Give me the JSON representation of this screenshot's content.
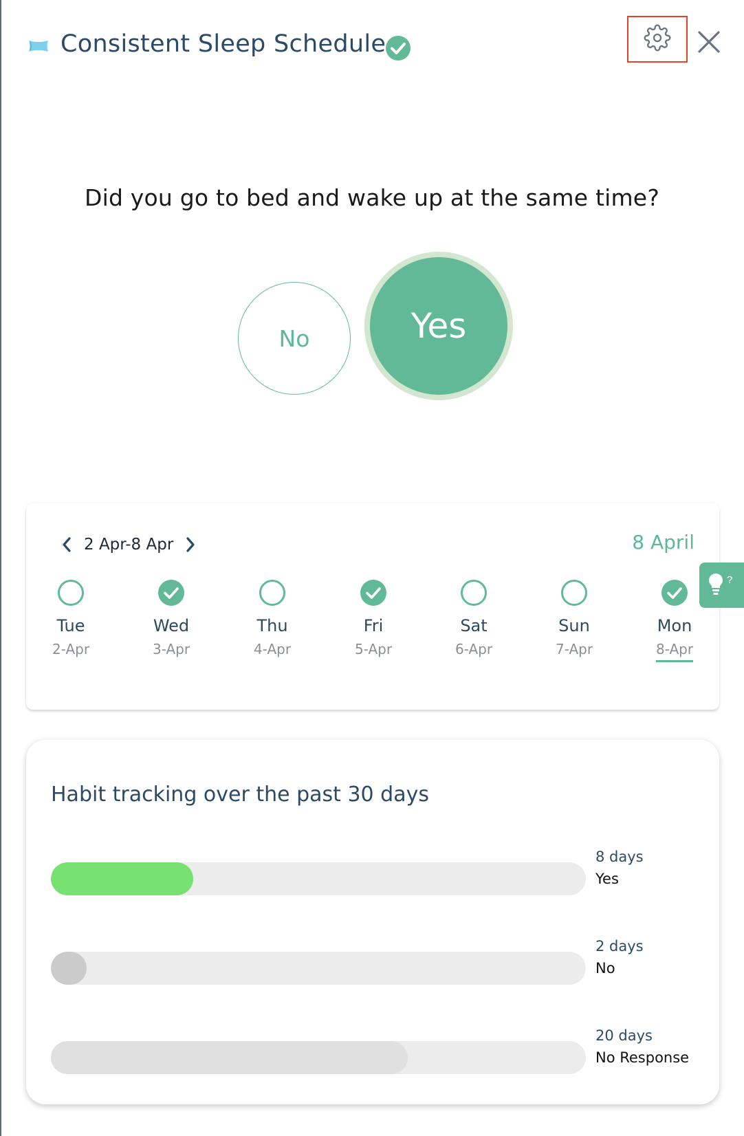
{
  "header": {
    "title": "Consistent Sleep Schedule",
    "icons": {
      "habit": "pillow-icon",
      "completed": "check-circle-icon",
      "settings": "gear-icon",
      "close": "close-icon"
    }
  },
  "question": {
    "text": "Did you go to bed and wake up at the same time?",
    "no_label": "No",
    "yes_label": "Yes",
    "selected": "Yes"
  },
  "week": {
    "range": "2 Apr-8 Apr",
    "current_date": "8 April",
    "days": [
      {
        "name": "Tue",
        "date": "2-Apr",
        "done": false
      },
      {
        "name": "Wed",
        "date": "3-Apr",
        "done": true
      },
      {
        "name": "Thu",
        "date": "4-Apr",
        "done": false
      },
      {
        "name": "Fri",
        "date": "5-Apr",
        "done": true
      },
      {
        "name": "Sat",
        "date": "6-Apr",
        "done": false
      },
      {
        "name": "Sun",
        "date": "7-Apr",
        "done": false
      },
      {
        "name": "Mon",
        "date": "8-Apr",
        "done": true,
        "selected": true
      }
    ]
  },
  "stats": {
    "title": "Habit tracking over the past 30 days",
    "total_days": 30,
    "bars": [
      {
        "count": "8 days",
        "label": "Yes",
        "days": 8,
        "color": "#77e272"
      },
      {
        "count": "2 days",
        "label": "No",
        "days": 2,
        "color": "#cbcbcb"
      },
      {
        "count": "20 days",
        "label": "No Response",
        "days": 20,
        "color": "#e0e0e0"
      }
    ]
  },
  "colors": {
    "accent": "#62b998",
    "title": "#2c4a66",
    "highlight_border": "#e2412e"
  }
}
